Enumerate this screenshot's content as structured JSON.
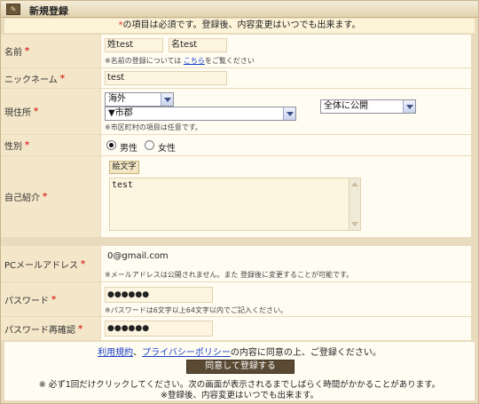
{
  "title": "新規登録",
  "notice": {
    "mark": "*",
    "text": "の項目は必須です。登録後、内容変更はいつでも出来ます。"
  },
  "required_mark": "*",
  "name": {
    "label": "名前",
    "sei_label": "姓",
    "sei_value": "test",
    "mei_label": "名",
    "mei_value": "test",
    "note_prefix": "※名前の登録については",
    "note_link": "こちら",
    "note_suffix": "をご覧ください"
  },
  "nickname": {
    "label": "ニックネーム",
    "value": "test"
  },
  "residence": {
    "label": "現住所",
    "country": "海外",
    "city": "▼市郡",
    "visibility": "全体に公開",
    "note": "※市区町村の項目は任意です。"
  },
  "gender": {
    "label": "性別",
    "male": "男性",
    "female": "女性",
    "selected": "male"
  },
  "intro": {
    "label": "自己紹介",
    "emoji_button": "絵文字",
    "value": "test"
  },
  "email": {
    "label": "PCメールアドレス",
    "value": "0@gmail.com",
    "note": "※メールアドレスは公開されません。また 登録後に変更することが可能です。"
  },
  "password": {
    "label": "パスワード",
    "value": "●●●●●●",
    "note": "※パスワードは6文字以上64文字以内でご記入ください。"
  },
  "password_confirm": {
    "label": "パスワード再確認",
    "value": "●●●●●●"
  },
  "footer": {
    "terms_link": "利用規約",
    "separator": "、",
    "privacy_link": "プライバシーポリシー",
    "agree_text": "の内容に同意の上、ご登録ください。",
    "submit": "同意して登録する",
    "note1": "※ 必ず1回だけクリックしてください。次の画面が表示されるまでしばらく時間がかかることがあります。",
    "note2": "※登録後、内容変更はいつでも出来ます。"
  }
}
